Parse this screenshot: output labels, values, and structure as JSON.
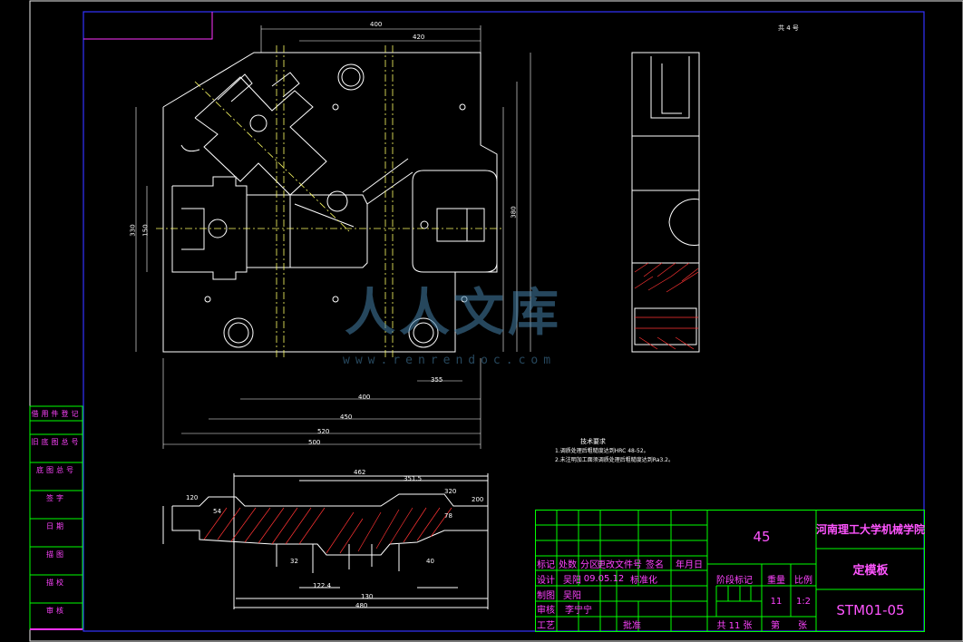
{
  "drawing": {
    "top_right_label": "共 4 号",
    "technical_requirements": {
      "title": "技术要求",
      "items": [
        "1.调质处理后粗糙度达到HRC 48-52。",
        "2.未注明加工面须调质处理后粗糙度达到Ra3.2。"
      ]
    },
    "dimensions_main": [
      "400",
      "420",
      "380",
      "330",
      "150",
      "355",
      "400",
      "450",
      "520",
      "500"
    ],
    "dimensions_section": [
      "462",
      "351.5",
      "320",
      "200",
      "120",
      "54",
      "78",
      "32",
      "40",
      "122.4",
      "130",
      "480"
    ]
  },
  "side_panel": {
    "items": [
      "借用件登记",
      "旧底图总号",
      "底图总号",
      "签字",
      "日期",
      "描图",
      "描校",
      "审核"
    ]
  },
  "title_block": {
    "material": "45",
    "school": "河南理工大学机械学院",
    "part_name": "定模板",
    "drawing_number": "STM01-05",
    "header_row": [
      "标记",
      "处数",
      "分区",
      "更改文件号",
      "签名",
      "年月日"
    ],
    "design_label": "设计",
    "design_name": "吴阳",
    "date": "09.05.12",
    "standardization_label": "标准化",
    "drafting_label": "制图",
    "drafting_name": "吴阳",
    "review_label": "审核",
    "review_name": "李宁宁",
    "process_label": "工艺",
    "approve_label": "批准",
    "stage_mark_label": "阶段标记",
    "weight_label": "重量",
    "scale_label": "比例",
    "weight_value": "11",
    "scale_value": "1:2",
    "total_sheets": "共 11 张",
    "sheet_label": "第",
    "sheet_unit": "张"
  },
  "watermark": {
    "text": "人人文库",
    "url": "www.renrendoc.com"
  },
  "colors": {
    "background": "#000000",
    "frame": "#2a2aff",
    "geometry": "#ffffff",
    "table_grid": "#00ff00",
    "table_text": "#ff44ff",
    "hatch": "#ff3333",
    "center_line": "#ffff66",
    "watermark": "#4682aa"
  }
}
